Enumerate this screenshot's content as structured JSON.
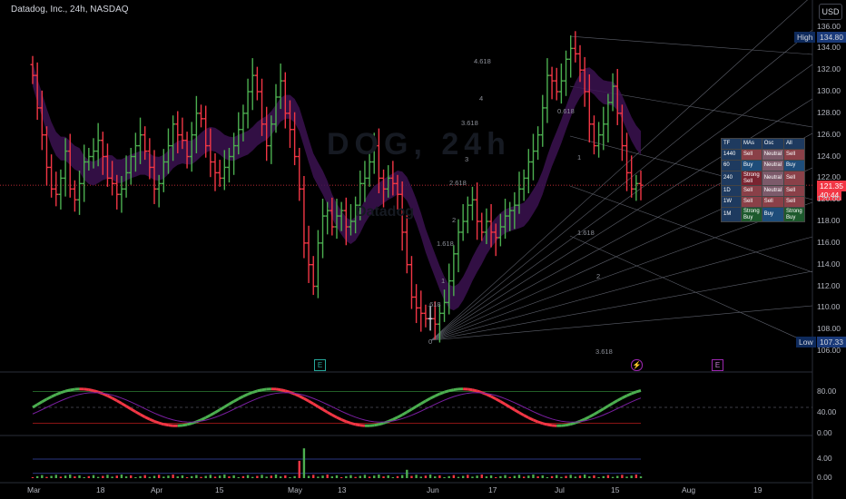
{
  "header": {
    "title": "Datadog, Inc., 24h, NASDAQ",
    "currency": "USD",
    "watermark_symbol": "DOG, 24h",
    "watermark_name": "Datadog"
  },
  "price_tags": {
    "high_label": "High",
    "high_value": "134.80",
    "low_label": "Low",
    "low_value": "107.33",
    "last_value": "121.35",
    "countdown": "40:44"
  },
  "y_axis": [
    "136.00",
    "134.00",
    "132.00",
    "130.00",
    "128.00",
    "126.00",
    "124.00",
    "122.00",
    "120.00",
    "118.00",
    "116.00",
    "114.00",
    "112.00",
    "110.00",
    "108.00",
    "106.00"
  ],
  "osc_axis": [
    "80.00",
    "40.00",
    "0.00"
  ],
  "vol_axis": [
    "4.00",
    "0.00"
  ],
  "x_axis": [
    "Mar",
    "18",
    "Apr",
    "15",
    "May",
    "13",
    "Jun",
    "17",
    "Jul",
    "15",
    "Aug",
    "19"
  ],
  "fib_labels_left": [
    "4.618",
    "4",
    "3.618",
    "3",
    "2.618",
    "2",
    "1.618",
    "1",
    ".618",
    "0"
  ],
  "fib_labels_right": [
    "0.618",
    "1",
    "1.618",
    "2",
    "3.618"
  ],
  "events": [
    {
      "icon": "E",
      "name": "earnings-marker"
    },
    {
      "icon": "⚡",
      "name": "split-marker"
    },
    {
      "icon": "E",
      "name": "earnings-marker-2"
    }
  ],
  "ta_table": {
    "headers": [
      "TF",
      "MAs",
      "Osc",
      "All"
    ],
    "rows": [
      {
        "tf": "1440",
        "mas": "Sell",
        "osc": "Neutral",
        "all": "Sell"
      },
      {
        "tf": "60",
        "mas": "Buy",
        "osc": "Neutral",
        "all": "Buy"
      },
      {
        "tf": "240",
        "mas": "Strong Sell",
        "osc": "Neutral",
        "all": "Sell"
      },
      {
        "tf": "1D",
        "mas": "Sell",
        "osc": "Neutral",
        "all": "Sell"
      },
      {
        "tf": "1W",
        "mas": "Sell",
        "osc": "Sell",
        "all": "Sell"
      },
      {
        "tf": "1M",
        "mas": "Strong Buy",
        "osc": "Buy",
        "all": "Strong Buy"
      }
    ]
  },
  "colors": {
    "up": "#4caf50",
    "down": "#f23645",
    "neutral": "#d1d4dc",
    "cloud_purple": "#3b1250",
    "cloud_blue": "#0d1a6b"
  },
  "chart_data": {
    "type": "ohlc",
    "ylim": [
      105.5,
      136.8
    ],
    "closes": [
      131.5,
      128.5,
      126.0,
      123.0,
      121.0,
      120.5,
      122.0,
      124.5,
      121.0,
      120.0,
      121.5,
      123.5,
      124.0,
      124.5,
      125.5,
      124.0,
      122.0,
      121.5,
      120.5,
      121.0,
      122.5,
      124.0,
      125.0,
      126.0,
      124.5,
      123.0,
      121.0,
      121.5,
      123.5,
      125.0,
      127.0,
      126.0,
      125.5,
      124.0,
      126.0,
      128.0,
      127.5,
      125.0,
      123.5,
      122.5,
      122.0,
      123.0,
      124.0,
      125.0,
      126.5,
      128.0,
      130.0,
      131.5,
      130.0,
      127.0,
      125.0,
      127.0,
      129.5,
      131.0,
      128.0,
      126.5,
      124.0,
      121.0,
      116.0,
      114.0,
      112.0,
      116.0,
      118.5,
      119.0,
      117.5,
      118.5,
      119.0,
      117.5,
      118.0,
      119.5,
      121.5,
      122.0,
      123.5,
      125.0,
      122.0,
      121.0,
      122.0,
      121.5,
      120.5,
      117.0,
      114.0,
      111.0,
      110.0,
      109.5,
      109.0,
      109.0,
      108.5,
      109.5,
      110.5,
      112.5,
      115.0,
      117.0,
      118.0,
      119.5,
      120.0,
      118.0,
      117.0,
      118.0,
      117.0,
      116.5,
      117.5,
      118.5,
      119.0,
      119.5,
      121.0,
      122.0,
      123.5,
      124.5,
      126.0,
      128.5,
      131.5,
      131.0,
      130.0,
      131.0,
      133.0,
      134.0,
      133.5,
      132.0,
      130.0,
      127.0,
      125.0,
      126.0,
      127.0,
      129.0,
      130.5,
      128.0,
      125.0,
      122.5,
      121.0,
      121.5,
      121.35
    ],
    "oscillator": {
      "ylim": [
        0,
        100
      ],
      "levels": [
        80,
        50,
        20
      ]
    },
    "volume": {
      "ylim": [
        0,
        8
      ],
      "levels": [
        4,
        1
      ]
    }
  }
}
